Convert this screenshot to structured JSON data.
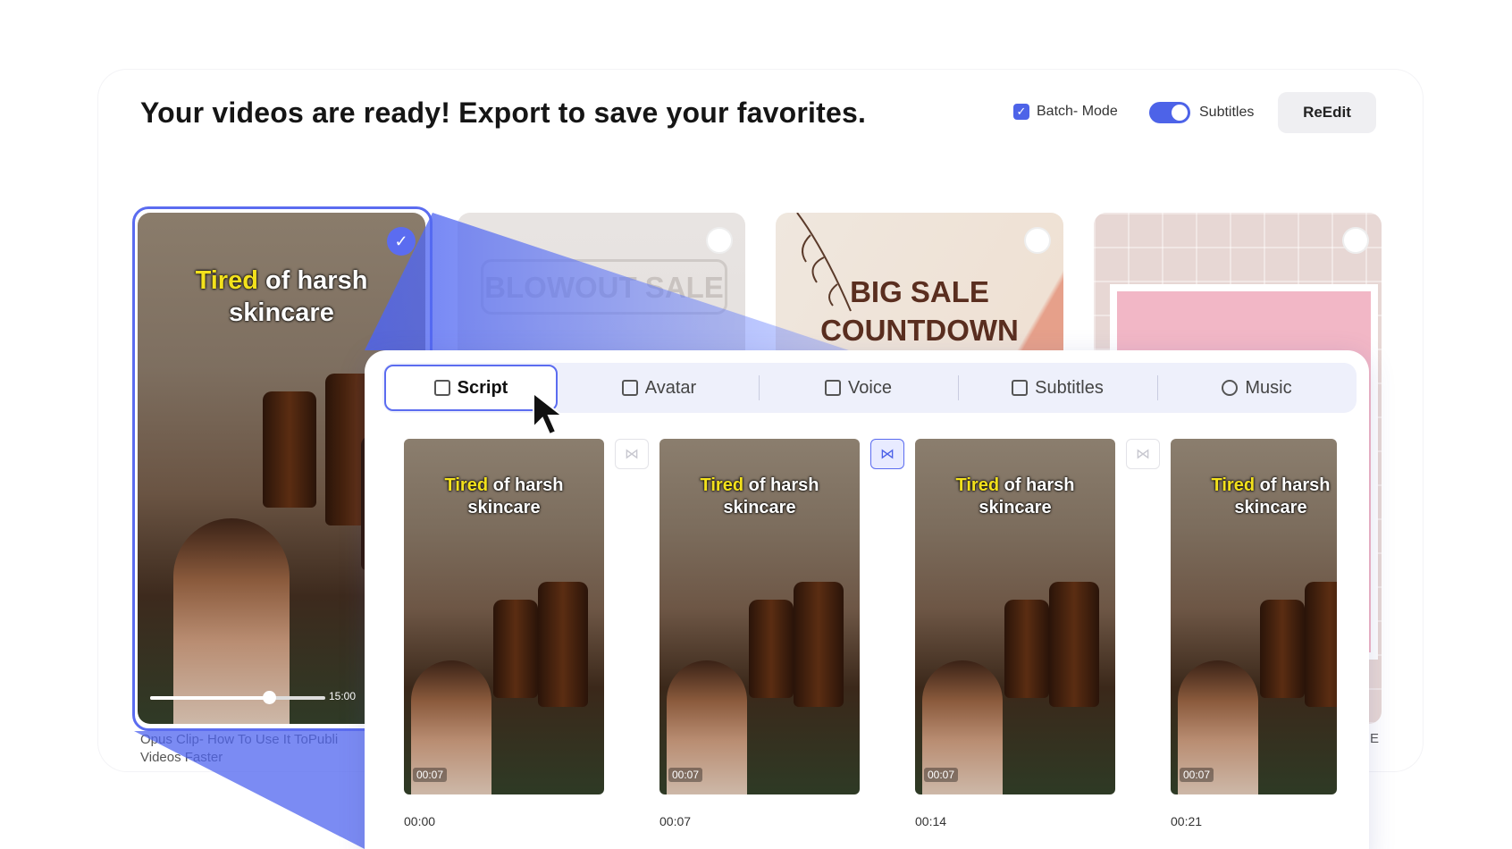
{
  "header": {
    "title": "Your videos are ready! Export to save your favorites.",
    "batch_mode_label": "Batch- Mode",
    "subtitles_label": "Subtitles",
    "reedit_label": "ReEdit"
  },
  "gallery": {
    "featured": {
      "caption_highlight": "Tired",
      "caption_rest": " of harsh",
      "caption_line2": "skincare",
      "duration": "15:00",
      "playback_progress": 0.68,
      "title": "Opus Clip- How To Use It ToPubli",
      "title_line2": "Videos Faster"
    },
    "templates": [
      {
        "text": "BLOWOUT SALE"
      },
      {
        "line1": "BIG SALE",
        "line2": "COUNTDOWN"
      },
      {
        "text": ""
      }
    ],
    "right_caption_fragment": "E"
  },
  "editor": {
    "tabs": [
      {
        "label": "Script",
        "icon": "script-icon"
      },
      {
        "label": "Avatar",
        "icon": "avatar-icon"
      },
      {
        "label": "Voice",
        "icon": "voice-icon"
      },
      {
        "label": "Subtitles",
        "icon": "subtitles-icon"
      },
      {
        "label": "Music",
        "icon": "music-icon"
      }
    ],
    "scenes": [
      {
        "highlight": "Tired",
        "rest": " of harsh",
        "line2": "skincare",
        "duration": "00:07",
        "start": "00:00"
      },
      {
        "highlight": "Tired",
        "rest": " of harsh",
        "line2": "skincare",
        "duration": "00:07",
        "start": "00:07"
      },
      {
        "highlight": "Tired",
        "rest": " of harsh",
        "line2": "skincare",
        "duration": "00:07",
        "start": "00:14"
      },
      {
        "highlight": "Tired",
        "rest": " of harsh",
        "line2": "skincare",
        "duration": "00:07",
        "start": "00:21"
      }
    ],
    "transitions": [
      {
        "icon": "transition-icon",
        "active": false
      },
      {
        "icon": "transition-icon",
        "active": true
      },
      {
        "icon": "transition-icon",
        "active": false
      }
    ]
  },
  "colors": {
    "accent": "#5b6cf0",
    "caption_highlight": "#f3e11c"
  }
}
